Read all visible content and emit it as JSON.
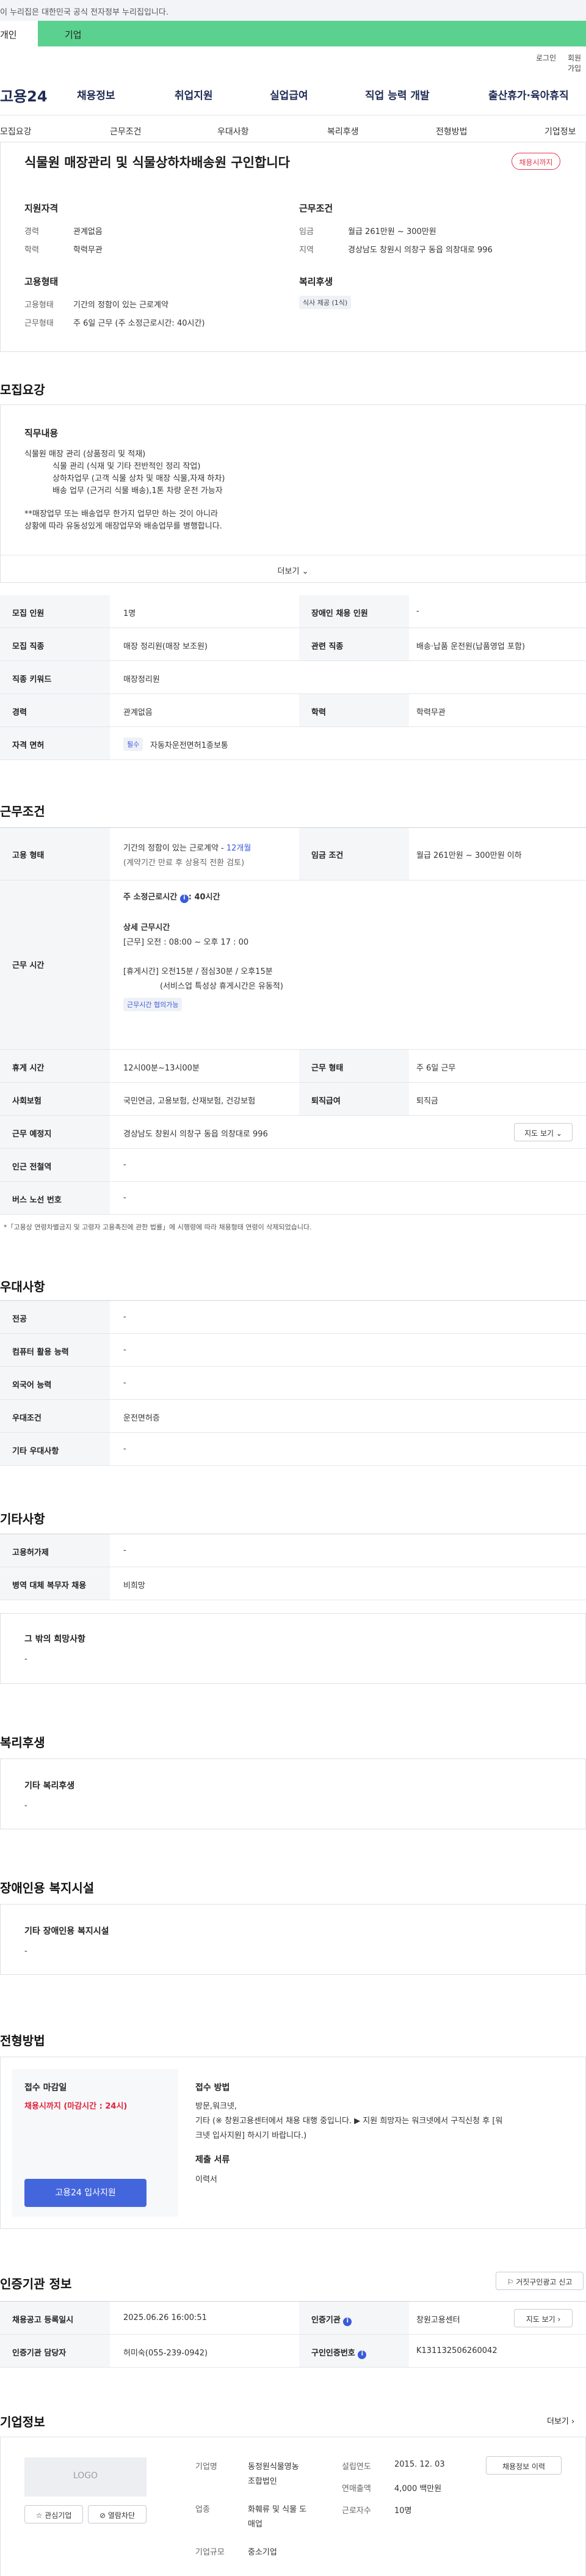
{
  "gov_banner": "이 누리집은 대한민국 공식 전자정부 누리집입니다.",
  "top_tabs": [
    "개인",
    "기업"
  ],
  "util": [
    "로그인",
    "회원가입"
  ],
  "logo": "고용24",
  "gnb": [
    "채용정보",
    "취업지원",
    "실업급여",
    "직업 능력 개발",
    "출산휴가·육아휴직"
  ],
  "subnav": [
    "모집요강",
    "근무조건",
    "우대사항",
    "복리후생",
    "전형방법",
    "기업정보"
  ],
  "job": {
    "title": "식물원 매장관리 및 식물상하차배송원 구인합니다",
    "deadline_badge": "채용시까지",
    "qual_title": "지원자격",
    "career_label": "경력",
    "career": "관계없음",
    "edu_label": "학력",
    "edu": "학력무관",
    "cond_title": "근무조건",
    "wage_label": "임금",
    "wage": "월급 261만원 ~ 300만원",
    "region_label": "지역",
    "region": "경상남도 창원시 의창구 동읍 의창대로 996",
    "emp_title": "고용형태",
    "emptype_label": "고용형태",
    "emptype": "기간의 정함이 있는 근로계약",
    "hours_label": "근무형태",
    "hours": "주 6일 근무 (주 소정근로시간: 40시간)",
    "welfare_title": "복리후생",
    "welfare_chip": "식사 제공 (1식)"
  },
  "recruit": {
    "section": "모집요강",
    "duty_title": "직무내용",
    "duty_lines": [
      "식물원 매장 관리 (상품정리 및 적재)",
      "식물 관리 (식재 및 기타 전반적인 정리 작업)",
      "상하차업무 (고객 식물 상차 및 매장 식물,자재 하차)",
      "배송 업무 (근거리 식물 배송),1톤 차량 운전 가능자",
      "",
      "**매장업무 또는 배송업무 한가지 업무만 하는 것이 아니라",
      "상황에 따라 유동성있게 매장업무와 배송업무를 병행합니다."
    ],
    "more": "더보기",
    "rows": [
      [
        "모집 인원",
        "1명",
        "장애인 채용 인원",
        "-"
      ],
      [
        "모집 직종",
        "매장 정리원(매장 보조원)",
        "관련 직종",
        "배송·납품 운전원(납품영업 포함)"
      ],
      [
        "직종 키워드",
        "매장정리원",
        "",
        ""
      ],
      [
        "경력",
        "관계없음",
        "학력",
        "학력무관"
      ]
    ],
    "license_label": "자격 면허",
    "license_chip": "필수",
    "license": "자동차운전면허1종보통"
  },
  "work": {
    "section": "근무조건",
    "emp_label": "고용 형태",
    "emp_line1": "기간의 정함이 있는 근로계약 -",
    "emp_months": "12개월",
    "emp_line2": "(계약기간 만료 후 상용직 전환 검토)",
    "wage_label": "임금 조건",
    "wage": "월급 261만원 ~ 300만원 이하",
    "time_label": "근무 시간",
    "weekly": "주 소정근로시간",
    "weekly_value": ": 40시간",
    "detail_title": "상세 근무시간",
    "detail1": "[근무] 오전 : 08:00 ~ 오후 17 : 00",
    "rest1": "[휴게시간] 오전15분 / 점심30분 / 오후15분",
    "rest2": "(서비스업 특성상 휴게시간은 유동적)",
    "chip": "근무시간 협의가능",
    "rows2": [
      [
        "휴게 시간",
        "12시00분~13시00분",
        "근무 형태",
        "주 6일 근무"
      ],
      [
        "사회보험",
        "국민연금, 고용보험, 산재보험, 건강보험",
        "퇴직급여",
        "퇴직금"
      ]
    ],
    "place_label": "근무 예정지",
    "place": "경상남도 창원시 의창구 동읍 의창대로 996",
    "map": "지도 보기",
    "near_label": "인근 전철역",
    "near": "-",
    "bus_label": "버스 노선 번호",
    "bus": "-",
    "note": "*「고용상 연령차별금지 및 고령자 고용촉진에 관한 법률」에 시행령에 따라 채용형태 연령이 삭제되었습니다."
  },
  "pref": {
    "section": "우대사항",
    "rows": [
      [
        "전공",
        "-"
      ],
      [
        "컴퓨터 활용 능력",
        "-"
      ],
      [
        "외국어 능력",
        "-"
      ],
      [
        "우대조건",
        "운전면허증"
      ],
      [
        "기타 우대사항",
        "-"
      ]
    ]
  },
  "etc": {
    "section": "기타사항",
    "rows": [
      [
        "고용허가제",
        "-"
      ],
      [
        "병역 대체 복무자 채용",
        "비희망"
      ]
    ],
    "hope_title": "그 밖의 희망사항",
    "hope": "-"
  },
  "welfare": {
    "section": "복리후생",
    "title": "기타 복리후생",
    "value": "-"
  },
  "disabled": {
    "section": "장애인용 복지시설",
    "title": "기타 장애인용 복지시설",
    "value": "-"
  },
  "apply": {
    "section": "전형방법",
    "deadline_title": "접수 마감일",
    "deadline": "채용시까지 (마감시간 : 24시)",
    "method_title": "접수 방법",
    "method1": "방문,워크넷,",
    "method2": "기타 (※ 창원고용센터에서 채용 대행 중입니다. ▶ 지원 희망자는 워크넷에서 구직신청 후 [워",
    "method3": "크넷 입사지원] 하시기 바랍니다.)",
    "docs_title": "제출 서류",
    "docs": "이력서",
    "apply_btn": "고용24 입사지원"
  },
  "cert": {
    "section": "인증기관 정보",
    "report_btn": "거짓구인광고 신고",
    "rows": [
      [
        "채용공고 등록일시",
        "2025.06.26 16:00:51",
        "인증기관",
        "창원고용센터"
      ],
      [
        "인증기관 담당자",
        "허미숙(055-239-0942)",
        "구인인증번호",
        "K131132506260042"
      ]
    ],
    "map": "지도 보기"
  },
  "company": {
    "section": "기업정보",
    "more": "더보기",
    "logo": "LOGO",
    "interest": "관심기업",
    "block": "열람차단",
    "name_label": "기업명",
    "name": "동정원식물영농",
    "name2": "조합법인",
    "ind_label": "업종",
    "ind": "화훼류 및 식물 도",
    "ind2": "매업",
    "size_label": "기업규모",
    "size": "중소기업",
    "est_label": "설립연도",
    "est": "2015. 12. 03",
    "sales_label": "연매출액",
    "sales": "4,000 백만원",
    "emp_label": "근로자수",
    "emp": "10명",
    "info_btn": "채용정보 이력"
  }
}
